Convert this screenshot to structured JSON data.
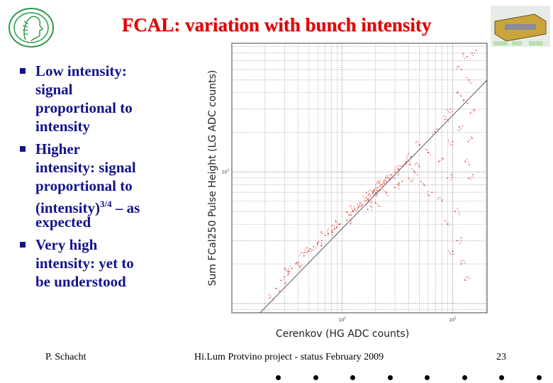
{
  "slide": {
    "title": "FCAL: variation with bunch intensity",
    "bullets": [
      {
        "lines": [
          "Low intensity:",
          "signal",
          "proportional to",
          "intensity"
        ]
      },
      {
        "lines": [
          "Higher",
          "intensity: signal",
          "proportional to"
        ],
        "last_line_base": "(intensity)",
        "last_line_sup": "3/4",
        "last_line_tail": " – as",
        "after": [
          "expected"
        ]
      },
      {
        "lines": [
          "Very high",
          "intensity: yet to",
          "be understood"
        ]
      }
    ],
    "footer": {
      "author": "P. Schacht",
      "center": "Hi.Lum Protvino project - status February 2009",
      "page": "23"
    },
    "colors": {
      "title": "#e00000",
      "text": "#13138a",
      "points": "#e02020",
      "logo": "#2e9a4a"
    },
    "icons": [
      "max-planck-logo",
      "detector-thumbnail"
    ]
  },
  "chart_data": {
    "type": "scatter",
    "title": "",
    "xlabel": "Cerenkov (HG ADC counts)",
    "ylabel": "Sum FCal250 Pulse Height (LG ADC counts)",
    "xscale": "log",
    "yscale": "log",
    "xlim": [
      10,
      2050
    ],
    "ylim": [
      85,
      9500
    ],
    "x_tick_labels": [
      {
        "value": 100,
        "base": "10",
        "exp": "2"
      },
      {
        "value": 1000,
        "base": "10",
        "exp": "3"
      }
    ],
    "y_tick_labels": [
      {
        "value": 1000,
        "base": "10",
        "exp": "3"
      }
    ],
    "grid": true,
    "point_color": "#e02020",
    "fit_line": [
      [
        18,
        85
      ],
      [
        2050,
        4980
      ]
    ],
    "points": [
      [
        22,
        110
      ],
      [
        25,
        130
      ],
      [
        28,
        150
      ],
      [
        30,
        160
      ],
      [
        33,
        175
      ],
      [
        35,
        185
      ],
      [
        38,
        200
      ],
      [
        40,
        205
      ],
      [
        45,
        230
      ],
      [
        48,
        245
      ],
      [
        50,
        250
      ],
      [
        55,
        270
      ],
      [
        60,
        290
      ],
      [
        65,
        300
      ],
      [
        70,
        330
      ],
      [
        75,
        340
      ],
      [
        80,
        350
      ],
      [
        85,
        370
      ],
      [
        90,
        380
      ],
      [
        95,
        400
      ],
      [
        110,
        430
      ],
      [
        120,
        470
      ],
      [
        125,
        500
      ],
      [
        130,
        520
      ],
      [
        140,
        540
      ],
      [
        145,
        580
      ],
      [
        150,
        560
      ],
      [
        160,
        600
      ],
      [
        165,
        640
      ],
      [
        170,
        620
      ],
      [
        175,
        680
      ],
      [
        180,
        660
      ],
      [
        190,
        700
      ],
      [
        195,
        720
      ],
      [
        200,
        690
      ],
      [
        210,
        760
      ],
      [
        220,
        780
      ],
      [
        230,
        800
      ],
      [
        240,
        820
      ],
      [
        250,
        850
      ],
      [
        260,
        900
      ],
      [
        270,
        880
      ],
      [
        280,
        950
      ],
      [
        300,
        1000
      ],
      [
        320,
        1050
      ],
      [
        350,
        1100
      ],
      [
        380,
        1200
      ],
      [
        420,
        1300
      ],
      [
        170,
        520
      ],
      [
        200,
        580
      ],
      [
        250,
        700
      ],
      [
        300,
        760
      ],
      [
        350,
        850
      ],
      [
        400,
        900
      ],
      [
        450,
        1000
      ],
      [
        500,
        1100
      ],
      [
        500,
        1600
      ],
      [
        550,
        800
      ],
      [
        600,
        1400
      ],
      [
        650,
        700
      ],
      [
        700,
        2000
      ],
      [
        750,
        1200
      ],
      [
        800,
        600
      ],
      [
        850,
        2500
      ],
      [
        900,
        900
      ],
      [
        950,
        3000
      ],
      [
        1000,
        1700
      ],
      [
        1050,
        500
      ],
      [
        1100,
        4000
      ],
      [
        1150,
        2200
      ],
      [
        1200,
        6000
      ],
      [
        1250,
        3500
      ],
      [
        1300,
        1200
      ],
      [
        1350,
        7500
      ],
      [
        1400,
        5000
      ],
      [
        1450,
        2800
      ],
      [
        1500,
        8000
      ],
      [
        1100,
        300
      ],
      [
        1200,
        200
      ],
      [
        1300,
        150
      ],
      [
        900,
        400
      ],
      [
        1000,
        250
      ],
      [
        1400,
        900
      ],
      [
        1500,
        1800
      ]
    ]
  }
}
